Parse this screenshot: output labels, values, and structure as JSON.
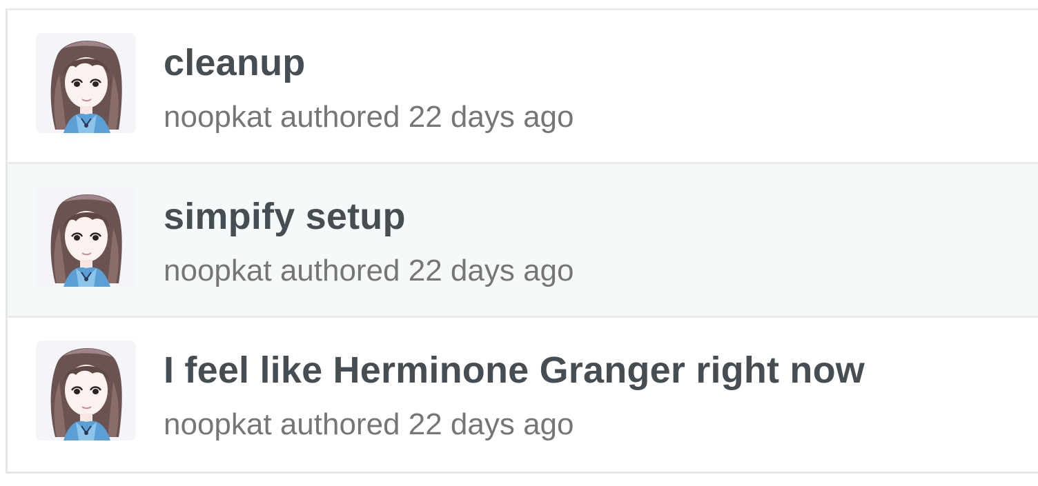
{
  "commits": [
    {
      "title": "cleanup",
      "author": "noopkat",
      "verb": "authored",
      "time": "22 days ago",
      "avatar_icon": "user-avatar-illustration"
    },
    {
      "title": "simpify setup",
      "author": "noopkat",
      "verb": "authored",
      "time": "22 days ago",
      "avatar_icon": "user-avatar-illustration"
    },
    {
      "title": "I feel like Herminone Granger right now",
      "author": "noopkat",
      "verb": "authored",
      "time": "22 days ago",
      "avatar_icon": "user-avatar-illustration"
    }
  ],
  "colors": {
    "title": "#464e53",
    "meta": "#767676",
    "alt_row_background": "#f6f9fa",
    "border": "#e6e6e6"
  }
}
